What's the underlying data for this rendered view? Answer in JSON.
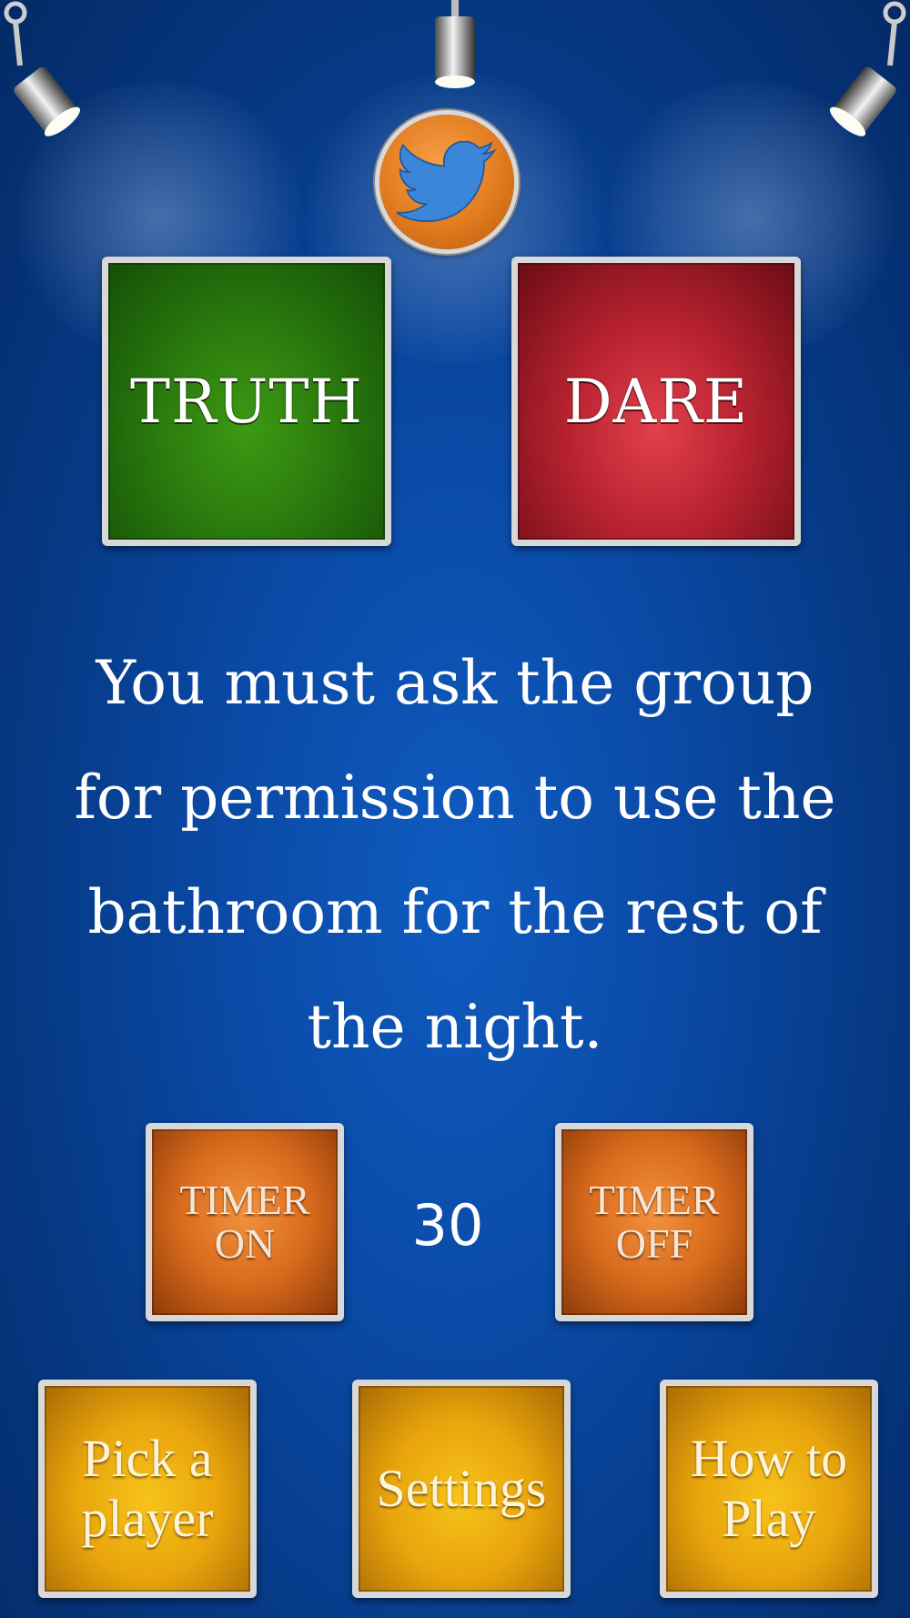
{
  "buttons": {
    "truth": "TRUTH",
    "dare": "DARE",
    "timer_on": "TIMER\nON",
    "timer_off": "TIMER\nOFF",
    "pick_player": "Pick a\nplayer",
    "settings": "Settings",
    "how_to_play": "How to\nPlay"
  },
  "dare_text": "You must ask the group for permission to use the bathroom for the rest of the night.",
  "timer_value": "30",
  "icons": {
    "share": "twitter-bird-icon",
    "lights": "spotlight-icon"
  },
  "colors": {
    "background": "#0a4aa6",
    "truth": "#2a7a0e",
    "dare": "#b82230",
    "timer": "#d96a1c",
    "menu": "#e8a40c",
    "twitter_badge": "#e37b1e",
    "twitter_bird": "#3b86d8"
  }
}
